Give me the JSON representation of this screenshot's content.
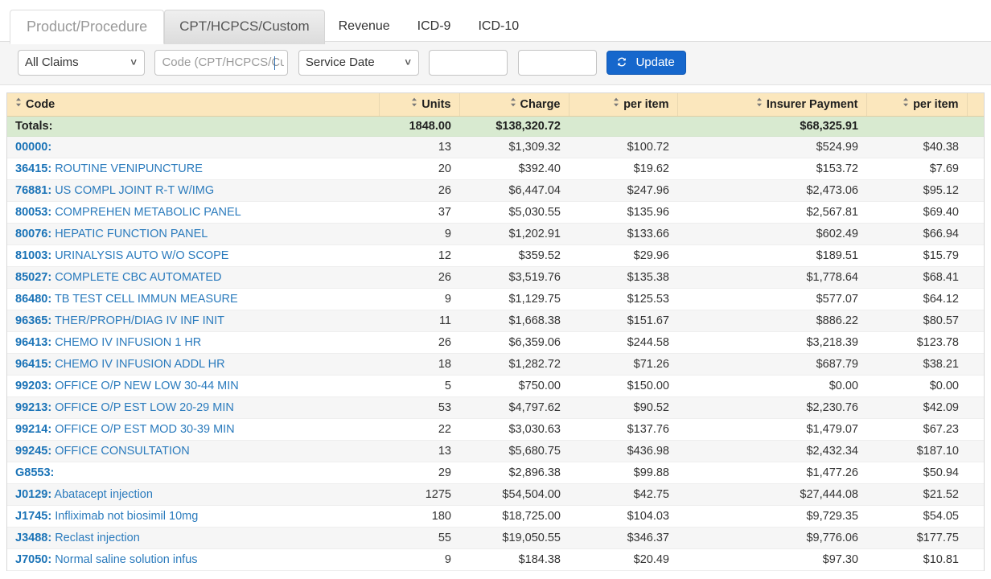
{
  "tabs": [
    {
      "label": "Product/Procedure",
      "state": "disabled"
    },
    {
      "label": "CPT/HCPCS/Custom",
      "state": "active"
    },
    {
      "label": "Revenue",
      "state": "plain"
    },
    {
      "label": "ICD-9",
      "state": "plain"
    },
    {
      "label": "ICD-10",
      "state": "plain"
    }
  ],
  "filters": {
    "claims_select": {
      "value": "All Claims",
      "icon": "chevron-down-icon"
    },
    "code_input": {
      "value": "",
      "placeholder": "Code (CPT/HCPCS/Cus"
    },
    "date_select": {
      "value": "Service Date",
      "icon": "chevron-down-icon"
    },
    "date_from": {
      "value": "",
      "placeholder": ""
    },
    "date_to": {
      "value": "",
      "placeholder": ""
    },
    "update_button": {
      "label": "Update",
      "icon": "refresh-icon",
      "color": "#1667cc"
    }
  },
  "table": {
    "columns": [
      {
        "key": "code",
        "label": "Code",
        "align": "left",
        "sortable": true
      },
      {
        "key": "units",
        "label": "Units",
        "align": "right",
        "sortable": true
      },
      {
        "key": "charge",
        "label": "Charge",
        "align": "right",
        "sortable": true
      },
      {
        "key": "charge_per_item",
        "label": "per item",
        "align": "right",
        "sortable": true
      },
      {
        "key": "insurer_payment",
        "label": "Insurer Payment",
        "align": "right",
        "sortable": true
      },
      {
        "key": "payment_per_item",
        "label": "per item",
        "align": "right",
        "sortable": true
      },
      {
        "key": "extra",
        "label": "",
        "align": "right",
        "sortable": false
      }
    ],
    "header_bg": "#fbe7bd",
    "totals_bg": "#d8ead0",
    "totals": {
      "label": "Totals:",
      "units": "1848.00",
      "charge": "$138,320.72",
      "charge_per_item": "",
      "insurer_payment": "$68,325.91",
      "payment_per_item": "",
      "extra": ""
    },
    "rows": [
      {
        "code": "00000",
        "desc": "",
        "units": "13",
        "charge": "$1,309.32",
        "charge_per_item": "$100.72",
        "insurer_payment": "$524.99",
        "payment_per_item": "$40.38"
      },
      {
        "code": "36415",
        "desc": "ROUTINE VENIPUNCTURE",
        "units": "20",
        "charge": "$392.40",
        "charge_per_item": "$19.62",
        "insurer_payment": "$153.72",
        "payment_per_item": "$7.69"
      },
      {
        "code": "76881",
        "desc": "US COMPL JOINT R-T W/IMG",
        "units": "26",
        "charge": "$6,447.04",
        "charge_per_item": "$247.96",
        "insurer_payment": "$2,473.06",
        "payment_per_item": "$95.12"
      },
      {
        "code": "80053",
        "desc": "COMPREHEN METABOLIC PANEL",
        "units": "37",
        "charge": "$5,030.55",
        "charge_per_item": "$135.96",
        "insurer_payment": "$2,567.81",
        "payment_per_item": "$69.40"
      },
      {
        "code": "80076",
        "desc": "HEPATIC FUNCTION PANEL",
        "units": "9",
        "charge": "$1,202.91",
        "charge_per_item": "$133.66",
        "insurer_payment": "$602.49",
        "payment_per_item": "$66.94"
      },
      {
        "code": "81003",
        "desc": "URINALYSIS AUTO W/O SCOPE",
        "units": "12",
        "charge": "$359.52",
        "charge_per_item": "$29.96",
        "insurer_payment": "$189.51",
        "payment_per_item": "$15.79"
      },
      {
        "code": "85027",
        "desc": "COMPLETE CBC AUTOMATED",
        "units": "26",
        "charge": "$3,519.76",
        "charge_per_item": "$135.38",
        "insurer_payment": "$1,778.64",
        "payment_per_item": "$68.41"
      },
      {
        "code": "86480",
        "desc": "TB TEST CELL IMMUN MEASURE",
        "units": "9",
        "charge": "$1,129.75",
        "charge_per_item": "$125.53",
        "insurer_payment": "$577.07",
        "payment_per_item": "$64.12"
      },
      {
        "code": "96365",
        "desc": "THER/PROPH/DIAG IV INF INIT",
        "units": "11",
        "charge": "$1,668.38",
        "charge_per_item": "$151.67",
        "insurer_payment": "$886.22",
        "payment_per_item": "$80.57"
      },
      {
        "code": "96413",
        "desc": "CHEMO IV INFUSION 1 HR",
        "units": "26",
        "charge": "$6,359.06",
        "charge_per_item": "$244.58",
        "insurer_payment": "$3,218.39",
        "payment_per_item": "$123.78"
      },
      {
        "code": "96415",
        "desc": "CHEMO IV INFUSION ADDL HR",
        "units": "18",
        "charge": "$1,282.72",
        "charge_per_item": "$71.26",
        "insurer_payment": "$687.79",
        "payment_per_item": "$38.21"
      },
      {
        "code": "99203",
        "desc": "OFFICE O/P NEW LOW 30-44 MIN",
        "units": "5",
        "charge": "$750.00",
        "charge_per_item": "$150.00",
        "insurer_payment": "$0.00",
        "payment_per_item": "$0.00"
      },
      {
        "code": "99213",
        "desc": "OFFICE O/P EST LOW 20-29 MIN",
        "units": "53",
        "charge": "$4,797.62",
        "charge_per_item": "$90.52",
        "insurer_payment": "$2,230.76",
        "payment_per_item": "$42.09"
      },
      {
        "code": "99214",
        "desc": "OFFICE O/P EST MOD 30-39 MIN",
        "units": "22",
        "charge": "$3,030.63",
        "charge_per_item": "$137.76",
        "insurer_payment": "$1,479.07",
        "payment_per_item": "$67.23"
      },
      {
        "code": "99245",
        "desc": "OFFICE CONSULTATION",
        "units": "13",
        "charge": "$5,680.75",
        "charge_per_item": "$436.98",
        "insurer_payment": "$2,432.34",
        "payment_per_item": "$187.10"
      },
      {
        "code": "G8553",
        "desc": "",
        "units": "29",
        "charge": "$2,896.38",
        "charge_per_item": "$99.88",
        "insurer_payment": "$1,477.26",
        "payment_per_item": "$50.94"
      },
      {
        "code": "J0129",
        "desc": "Abatacept injection",
        "units": "1275",
        "charge": "$54,504.00",
        "charge_per_item": "$42.75",
        "insurer_payment": "$27,444.08",
        "payment_per_item": "$21.52"
      },
      {
        "code": "J1745",
        "desc": "Infliximab not biosimil 10mg",
        "units": "180",
        "charge": "$18,725.00",
        "charge_per_item": "$104.03",
        "insurer_payment": "$9,729.35",
        "payment_per_item": "$54.05"
      },
      {
        "code": "J3488",
        "desc": "Reclast injection",
        "units": "55",
        "charge": "$19,050.55",
        "charge_per_item": "$346.37",
        "insurer_payment": "$9,776.06",
        "payment_per_item": "$177.75"
      },
      {
        "code": "J7050",
        "desc": "Normal saline solution infus",
        "units": "9",
        "charge": "$184.38",
        "charge_per_item": "$20.49",
        "insurer_payment": "$97.30",
        "payment_per_item": "$10.81"
      }
    ]
  }
}
